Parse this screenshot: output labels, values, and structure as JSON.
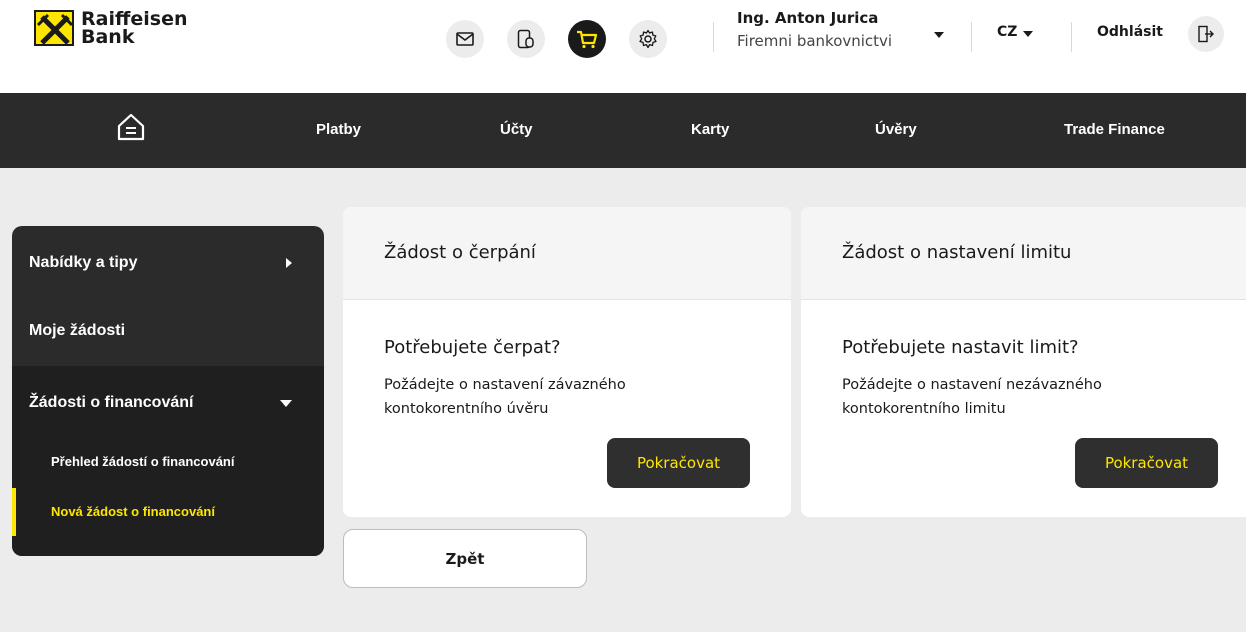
{
  "logo": {
    "line1": "Raiffeisen",
    "line2": "Bank"
  },
  "header": {
    "icons": [
      "mail-icon",
      "device-icon",
      "cart-icon",
      "gear-icon"
    ],
    "user_name": "Ing. Anton Jurica",
    "user_role": "Firemni bankovnictvi",
    "language": "CZ",
    "logout_label": "Odhlásit"
  },
  "nav": {
    "home_icon": "home-icon",
    "items": [
      "Platby",
      "Účty",
      "Karty",
      "Úvěry",
      "Trade Finance"
    ]
  },
  "sidebar": {
    "items": [
      "Nabídky a tipy",
      "Moje žádosti",
      "Žádosti o financování"
    ],
    "subitems": [
      "Přehled žádostí o financování",
      "Nová žádost o financování"
    ],
    "active_color": "#fee600"
  },
  "cards": [
    {
      "header": "Žádost o čerpání",
      "title": "Potřebujete čerpat?",
      "desc_line1": "Požádejte o nastavení závazného",
      "desc_line2": "kontokorentního úvěru",
      "button": "Pokračovat"
    },
    {
      "header": "Žádost o nastavení limitu",
      "title": "Potřebujete nastavit limit?",
      "desc_line1": "Požádejte o nastavení nezávazného",
      "desc_line2": "kontokorentního limitu",
      "button": "Pokračovat"
    }
  ],
  "back_label": "Zpět",
  "colors": {
    "brand_yellow": "#fee600",
    "dark": "#2b2b2b",
    "background": "#ececec"
  }
}
